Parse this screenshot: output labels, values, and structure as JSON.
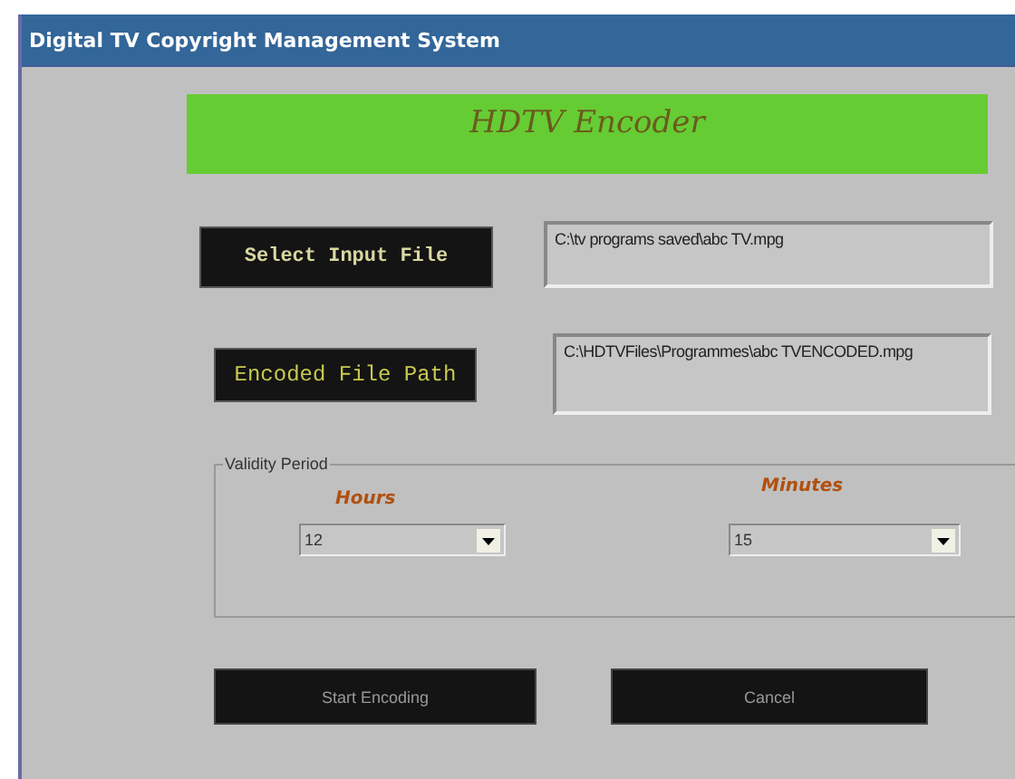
{
  "window": {
    "title": "Digital TV Copyright Management System"
  },
  "banner": "HDTV Encoder",
  "files": [
    {
      "button": "Select Input File",
      "value": "C:\\tv programs saved\\abc TV.mpg"
    },
    {
      "button": "Encoded File Path",
      "value": "C:\\HDTVFiles\\Programmes\\abc TVENCODED.mpg"
    }
  ],
  "validity": {
    "legend": "Validity Period",
    "hours": {
      "label": "Hours",
      "value": "12"
    },
    "minutes": {
      "label": "Minutes",
      "value": "15"
    }
  },
  "buttons": [
    "Start Encoding",
    "Cancel"
  ]
}
